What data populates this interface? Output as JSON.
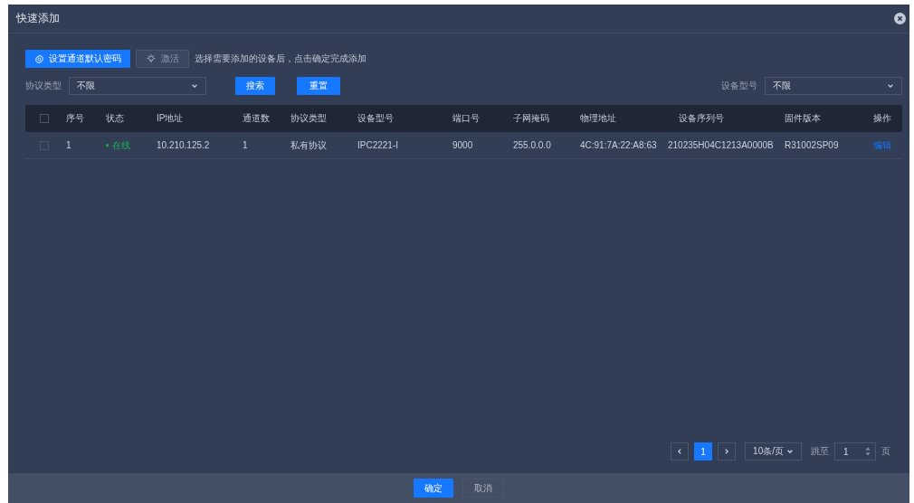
{
  "window": {
    "title": "快速添加"
  },
  "toolbar": {
    "set_password_button": "设置通道默认密码",
    "activate_button": {
      "label": "激活",
      "disabled": true
    },
    "hint": "选择需要添加的设备后，点击确定完成添加"
  },
  "filters": {
    "protocol": {
      "label": "协议类型",
      "value": "不限"
    },
    "search_button": "搜索",
    "reset_button": "重置",
    "model": {
      "label": "设备型号",
      "value": "不限"
    }
  },
  "table": {
    "select_all_checked": false,
    "columns": [
      "序号",
      "状态",
      "IP地址",
      "通道数",
      "协议类型",
      "设备型号",
      "端口号",
      "子网掩码",
      "物理地址",
      "设备序列号",
      "固件版本",
      "操作"
    ],
    "rows": [
      {
        "checked": false,
        "index": "1",
        "status": {
          "text": "在线",
          "color": "#1fb25a"
        },
        "ip": "10.210.125.2",
        "channels": "1",
        "protocol": "私有协议",
        "model": "IPC2221-I",
        "port": "9000",
        "subnet": "255.0.0.0",
        "mac": "4C:91:7A:22:A8:63",
        "serial": "210235H04C1213A0000B",
        "firmware": "R31002SP09",
        "action": "编辑"
      }
    ]
  },
  "pagination": {
    "pages": [
      {
        "label": "1",
        "selected": true
      }
    ],
    "page_size": "10条/页",
    "jump_label": "跳至",
    "jump_value": "1",
    "page_suffix": "页"
  },
  "footer": {
    "ok_button": "确定",
    "cancel_button": "取消"
  }
}
